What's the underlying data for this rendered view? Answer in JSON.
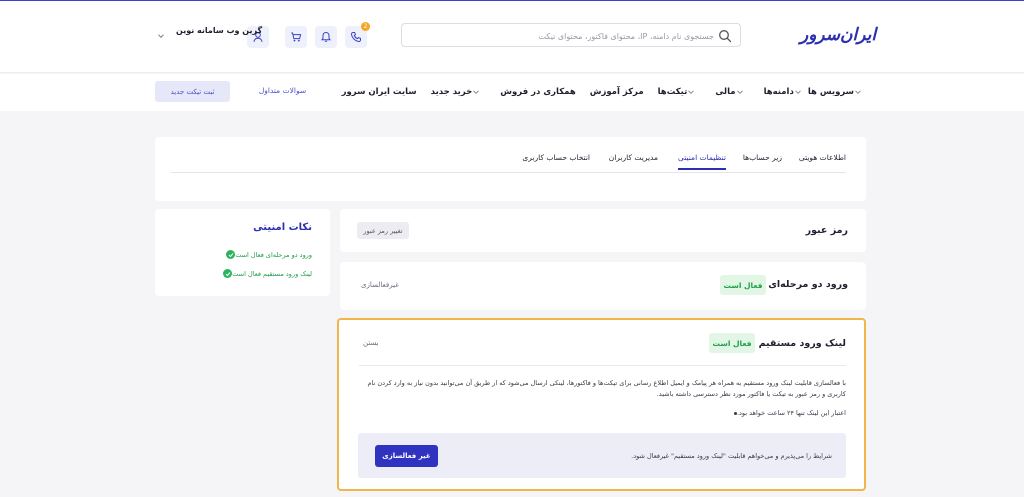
{
  "header": {
    "logo_text": "ایران‌سرور",
    "search_placeholder": "جستجوی نام دامنه، IP، محتوای فاکتور، محتوای تیکت",
    "notification_count": "2",
    "user_name": "گرین وب سامانه نوین"
  },
  "nav": {
    "items": [
      {
        "label": "سرویس ها",
        "dropdown": true
      },
      {
        "label": "دامنه‌ها",
        "dropdown": true
      },
      {
        "label": "مالی",
        "dropdown": true
      },
      {
        "label": "تیکت‌ها",
        "dropdown": true
      },
      {
        "label": "مرکز آموزش",
        "dropdown": false
      },
      {
        "label": "همکاری در فروش",
        "dropdown": false
      },
      {
        "label": "خرید جدید",
        "dropdown": true
      },
      {
        "label": "سایت ایران سرور",
        "dropdown": false
      }
    ],
    "faq_label": "سوالات متداول",
    "new_ticket_label": "ثبت تیکت جدید"
  },
  "tabs": [
    {
      "label": "اطلاعات هویتی",
      "active": false
    },
    {
      "label": "زیر حساب‌ها",
      "active": false
    },
    {
      "label": "تنظیمات امنیتی",
      "active": true
    },
    {
      "label": "مدیریت کاربران",
      "active": false
    },
    {
      "label": "انتخاب حساب کاربری",
      "active": false
    }
  ],
  "security_tips": {
    "title": "نکات امنیتی",
    "items": [
      "ورود دو مرحله‌ای فعال است",
      "لینک ورود مستقیم فعال است"
    ]
  },
  "password": {
    "title": "رمز عبور",
    "change_label": "تغییر رمز عبور"
  },
  "two_factor": {
    "title": "ورود دو مرحله‌ای",
    "status": "فعال است",
    "action_label": "غیرفعالسازی"
  },
  "direct_link": {
    "title": "لینک ورود مستقیم",
    "status": "فعال است",
    "close_label": "بستن",
    "description": "با فعالسازی قابلیت لینک ورود مستقیم به همراه هر پیامک و ایمیل اطلاع رسانی برای تیکت‌ها و فاکتورها، لینکی ارسال می‌شود که از طریق آن می‌توانید بدون نیاز به وارد کردن نام کاربری و رمز عبور به تیکت یا فاکتور مورد نظر دسترسی داشته باشید.",
    "bullet": "اعتبار این لینک تنها ۲۴ ساعت خواهد بود.",
    "confirm_text": "شرایط را می‌پذیرم و می‌خواهم قابلیت \"لینک ورود مستقیم\" غیرفعال شود.",
    "deactivate_label": "غیر فعالسازی"
  },
  "colors": {
    "brand": "#2b2fb0",
    "success": "#1f9d4a",
    "highlight_border": "#f0b64a"
  }
}
